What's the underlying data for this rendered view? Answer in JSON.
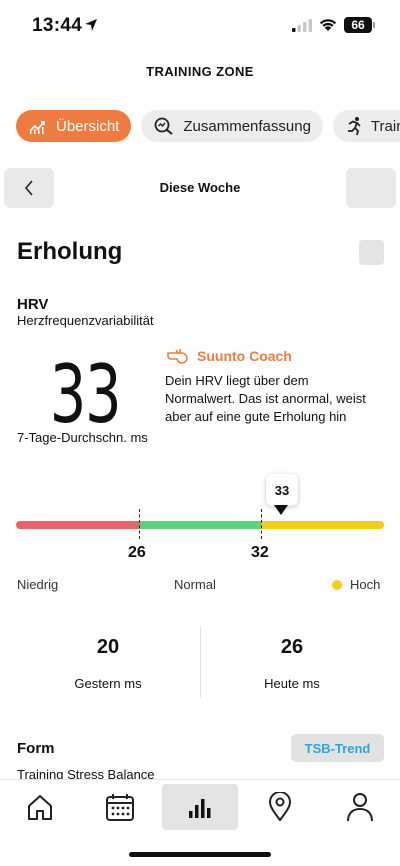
{
  "status": {
    "time": "13:44",
    "battery": "66"
  },
  "app": {
    "title": "TRAINING ZONE"
  },
  "tabs": [
    {
      "label": "Übersicht",
      "icon": "chart-icon",
      "active": true
    },
    {
      "label": "Zusammenfassung",
      "icon": "search-icon",
      "active": false
    },
    {
      "label": "Traini",
      "icon": "runner-icon",
      "active": false
    }
  ],
  "week": {
    "label": "Diese Woche"
  },
  "section": {
    "title": "Erholung"
  },
  "hrv": {
    "title": "HRV",
    "subtitle": "Herzfrequenzvariabilität",
    "value": "33",
    "avg_label": "7-Tage-Durchschn. ms"
  },
  "coach": {
    "title": "Suunto Coach",
    "text": "Dein HRV liegt über dem Normalwert. Das ist anormal, weist aber auf eine gute Erholung hin"
  },
  "range": {
    "current": "33",
    "tick_low": "26",
    "tick_high": "32",
    "label_low": "Niedrig",
    "label_mid": "Normal",
    "label_high": "Hoch",
    "colors": {
      "low": "#e5646a",
      "normal": "#5dd27a",
      "high": "#f5cd13"
    }
  },
  "stats": {
    "yesterday_value": "20",
    "yesterday_label": "Gestern ms",
    "today_value": "26",
    "today_label": "Heute ms"
  },
  "form": {
    "title": "Form",
    "button": "TSB-Trend",
    "subtitle": "Training Stress Balance"
  },
  "nav": [
    {
      "icon": "home-icon"
    },
    {
      "icon": "calendar-icon"
    },
    {
      "icon": "bar-chart-icon",
      "active": true
    },
    {
      "icon": "map-pin-icon"
    },
    {
      "icon": "profile-icon"
    }
  ],
  "colors": {
    "accent": "#f07b3f",
    "link": "#2aa6d8"
  }
}
